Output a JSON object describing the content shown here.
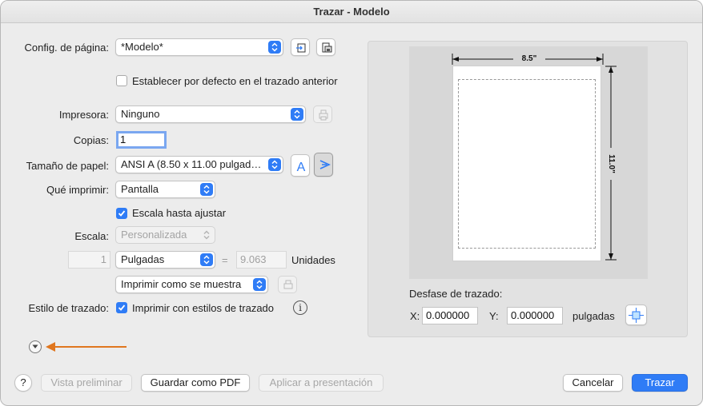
{
  "window": {
    "title": "Trazar - Modelo"
  },
  "page_setup": {
    "label": "Config. de página:",
    "value": "*Modelo*",
    "default_checkbox_label": "Establecer por defecto en el trazado anterior",
    "default_checked": false
  },
  "printer": {
    "label": "Impresora:",
    "value": "Ninguno"
  },
  "copies": {
    "label": "Copias:",
    "value": "1"
  },
  "paper_size": {
    "label": "Tamaño de papel:",
    "value": "ANSI A (8.50 x 11.00 pulgadas)"
  },
  "what_to_print": {
    "label": "Qué imprimir:",
    "value": "Pantalla"
  },
  "fit_to_scale": {
    "label": "Escala hasta ajustar",
    "checked": true
  },
  "scale": {
    "label": "Escala:",
    "value": "Personalizada",
    "numerator": "1",
    "units_value": "Pulgadas",
    "equals": "=",
    "denominator": "9.063",
    "units_label": "Unidades"
  },
  "shaded": {
    "value": "Imprimir como se muestra"
  },
  "plot_style": {
    "label": "Estilo de trazado:",
    "checkbox_label": "Imprimir con estilos de trazado",
    "checked": true
  },
  "preview": {
    "width_label": "8.5\"",
    "height_label": "11.0\""
  },
  "offset": {
    "label": "Desfase de trazado:",
    "x_label": "X:",
    "x_value": "0.000000",
    "y_label": "Y:",
    "y_value": "0.000000",
    "units": "pulgadas"
  },
  "buttons": {
    "help": "?",
    "preview": "Vista preliminar",
    "save_pdf": "Guardar como PDF",
    "apply_layout": "Aplicar a presentación",
    "cancel": "Cancelar",
    "plot": "Trazar"
  },
  "colors": {
    "accent": "#2f7cf6",
    "arrow": "#e0761e"
  }
}
